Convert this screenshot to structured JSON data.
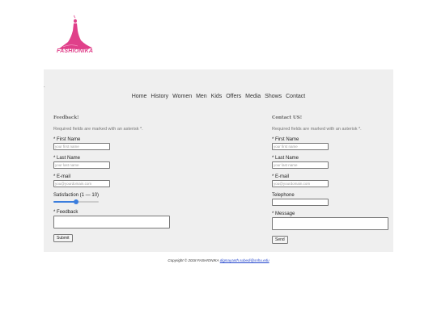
{
  "brand": {
    "name": "FASHIONIKA",
    "color": "#e0408a"
  },
  "nav": {
    "items": [
      "Home",
      "History",
      "Women",
      "Men",
      "Kids",
      "Offers",
      "Media",
      "Shows",
      "Contact"
    ]
  },
  "feedback": {
    "title": "Feedback!",
    "required_note": "Required fields are marked with an asterisk *.",
    "first_name_label": "* First Name",
    "first_name_placeholder": "your first name",
    "last_name_label": "* Last Name",
    "last_name_placeholder": "your last name",
    "email_label": "* E-mail",
    "email_placeholder": "you@yourdomain.com",
    "satisfaction_label": "Satisfaction (1 — 10)",
    "satisfaction_value": 5,
    "satisfaction_max": 10,
    "feedback_label": "* Feedback",
    "submit_label": "Submit"
  },
  "contact": {
    "title": "Contact US!",
    "required_note": "Required fields are marked with an asterisk *.",
    "first_name_label": "* First Name",
    "first_name_placeholder": "your first name",
    "last_name_label": "* Last Name",
    "last_name_placeholder": "your last name",
    "email_label": "* E-mail",
    "email_placeholder": "you@yourdomain.com",
    "telephone_label": "Telephone",
    "message_label": "* Message",
    "send_label": "Send"
  },
  "footer": {
    "text": "Copyright © 2018 FASHIONIKA",
    "email": "digmayanth.subedi@snhu.edu"
  },
  "colors": {
    "panel": "#efefef",
    "slider": "#3b7ddd",
    "link": "#2244cc"
  }
}
